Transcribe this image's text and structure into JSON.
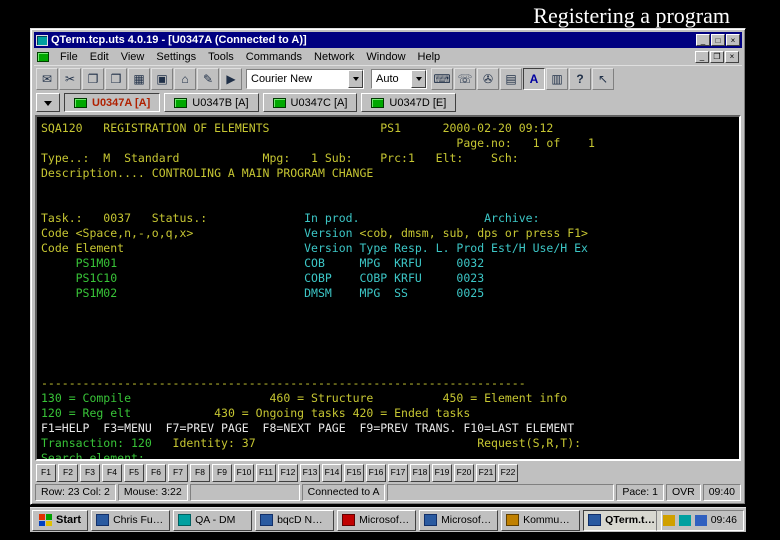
{
  "slide": {
    "title": "Registering a program"
  },
  "colors": {
    "terminal_yellow": "#c6c632",
    "terminal_green": "#38c438",
    "terminal_cyan": "#3cc6c6",
    "terminal_white": "#e8e8e8",
    "titlebar": "#000080",
    "chrome": "#c0c0c0",
    "active_tab_label": "#b02000"
  },
  "window": {
    "title": "QTerm.tcp.uts 4.0.19 - [U0347A (Connected to A)]",
    "controls": {
      "minimize": "_",
      "maximize": "□",
      "close": "×"
    },
    "mdi_controls": {
      "minimize": "_",
      "restore": "❐",
      "close": "×"
    },
    "menus": [
      "File",
      "Edit",
      "View",
      "Settings",
      "Tools",
      "Commands",
      "Network",
      "Window",
      "Help"
    ],
    "toolbar": {
      "font_select": "Courier New",
      "mode_select": "Auto",
      "icons1": [
        {
          "name": "new-session-icon",
          "glyph": "✉"
        },
        {
          "name": "cut-icon",
          "glyph": "✂"
        },
        {
          "name": "copy-icon",
          "glyph": "❐"
        },
        {
          "name": "paste-icon",
          "glyph": "❒"
        },
        {
          "name": "mark-icon",
          "glyph": "▦"
        },
        {
          "name": "screen-icon",
          "glyph": "▣"
        },
        {
          "name": "host-icon",
          "glyph": "⌂"
        },
        {
          "name": "edit-icon",
          "glyph": "✎"
        },
        {
          "name": "run-icon",
          "glyph": "▶"
        }
      ],
      "icons2": [
        {
          "name": "keyboard-map-icon",
          "glyph": "⌨"
        },
        {
          "name": "phone-icon",
          "glyph": "☏"
        },
        {
          "name": "save-icon",
          "glyph": "✇"
        },
        {
          "name": "print-icon",
          "glyph": "▤"
        },
        {
          "name": "font-icon",
          "glyph": "A"
        },
        {
          "name": "chart-icon",
          "glyph": "▥"
        },
        {
          "name": "help-icon",
          "glyph": "?"
        },
        {
          "name": "context-help-icon",
          "glyph": "↖"
        }
      ]
    },
    "tabs": [
      {
        "label": "U0347A [A]",
        "active": true
      },
      {
        "label": "U0347B [A]",
        "active": false
      },
      {
        "label": "U0347C [A]",
        "active": false
      },
      {
        "label": "U0347D [E]",
        "active": false
      }
    ],
    "terminal": {
      "lines": [
        [
          {
            "c": "y",
            "t": "SQA120   REGISTRATION OF ELEMENTS                PS1      2000-02-20 09:12"
          }
        ],
        [
          {
            "c": "y",
            "t": "                                                            Page.no:   1 of    1"
          }
        ],
        [
          {
            "c": "y",
            "t": "Type..:  M  Standard            Mpg:   1 Sub:    Prc:1   Elt:    Sch:"
          }
        ],
        [
          {
            "c": "y",
            "t": "Description.... CONTROLING A MAIN PROGRAM CHANGE"
          }
        ],
        [],
        [],
        [
          {
            "c": "y",
            "t": "Task.:   0037   Status.:"
          },
          {
            "c": "c",
            "t": "              In prod.                  Archive:"
          }
        ],
        [
          {
            "c": "y",
            "t": "Code <Space,n,-,o,q,x>"
          },
          {
            "c": "c",
            "t": "                Version "
          },
          {
            "c": "y",
            "t": "<cob, dmsm, sub, dps or press F1>"
          }
        ],
        [
          {
            "c": "y",
            "t": "Code Element"
          },
          {
            "c": "c",
            "t": "                          Version Type Resp. L. Prod Est/H Use/H Ex"
          }
        ],
        [
          {
            "c": "g",
            "t": "     PS1M01"
          },
          {
            "c": "c",
            "t": "                           COB     MPG  KRFU     0032"
          }
        ],
        [
          {
            "c": "g",
            "t": "     PS1C10"
          },
          {
            "c": "c",
            "t": "                           COBP    COBP KRFU     0023"
          }
        ],
        [
          {
            "c": "g",
            "t": "     PS1M02"
          },
          {
            "c": "c",
            "t": "                           DMSM    MPG  SS       0025"
          }
        ],
        [],
        [],
        [],
        [],
        [],
        [
          {
            "c": "y",
            "t": "----------------------------------------------------------------------"
          }
        ],
        [
          {
            "c": "g",
            "t": "130 = Compile"
          },
          {
            "c": "y",
            "t": "                    460 = Structure          450 = Element info"
          }
        ],
        [
          {
            "c": "g",
            "t": "120 = Reg elt"
          },
          {
            "c": "y",
            "t": "            430 = Ongoing tasks 420 = Ended tasks"
          }
        ],
        [
          {
            "c": "w",
            "t": "F1=HELP  F3=MENU  F7=PREV PAGE  F8=NEXT PAGE  F9=PREV TRANS. F10=LAST ELEMENT"
          }
        ],
        [
          {
            "c": "g",
            "t": "Transaction: 120"
          },
          {
            "c": "y",
            "t": "   Identity: 37                                Request(S,R,T):"
          }
        ],
        [
          {
            "c": "g",
            "t": "Search element:"
          }
        ]
      ]
    },
    "fkeys": [
      "F1",
      "F2",
      "F3",
      "F4",
      "F5",
      "F6",
      "F7",
      "F8",
      "F9",
      "F10",
      "F11",
      "F12",
      "F13",
      "F14",
      "F15",
      "F16",
      "F17",
      "F18",
      "F19",
      "F20",
      "F21",
      "F22"
    ],
    "statusbar": {
      "row_col": "Row: 23  Col: 2",
      "mouse": "Mouse: 3:22",
      "connection": "Connected to A",
      "pace": "Pace: 1",
      "mode": "OVR",
      "time": "09:40"
    }
  },
  "taskbar": {
    "start": "Start",
    "buttons": [
      {
        "label": "Chris Furme...",
        "active": false
      },
      {
        "label": "QA - DM",
        "active": false
      },
      {
        "label": "bqcD NCK...",
        "active": false
      },
      {
        "label": "Microsoft W...",
        "active": false
      },
      {
        "label": "Microsoft P...",
        "active": false
      },
      {
        "label": "Kommunika...",
        "active": false
      },
      {
        "label": "QTerm.tc...",
        "active": true
      }
    ],
    "tray_time": "09:46"
  }
}
